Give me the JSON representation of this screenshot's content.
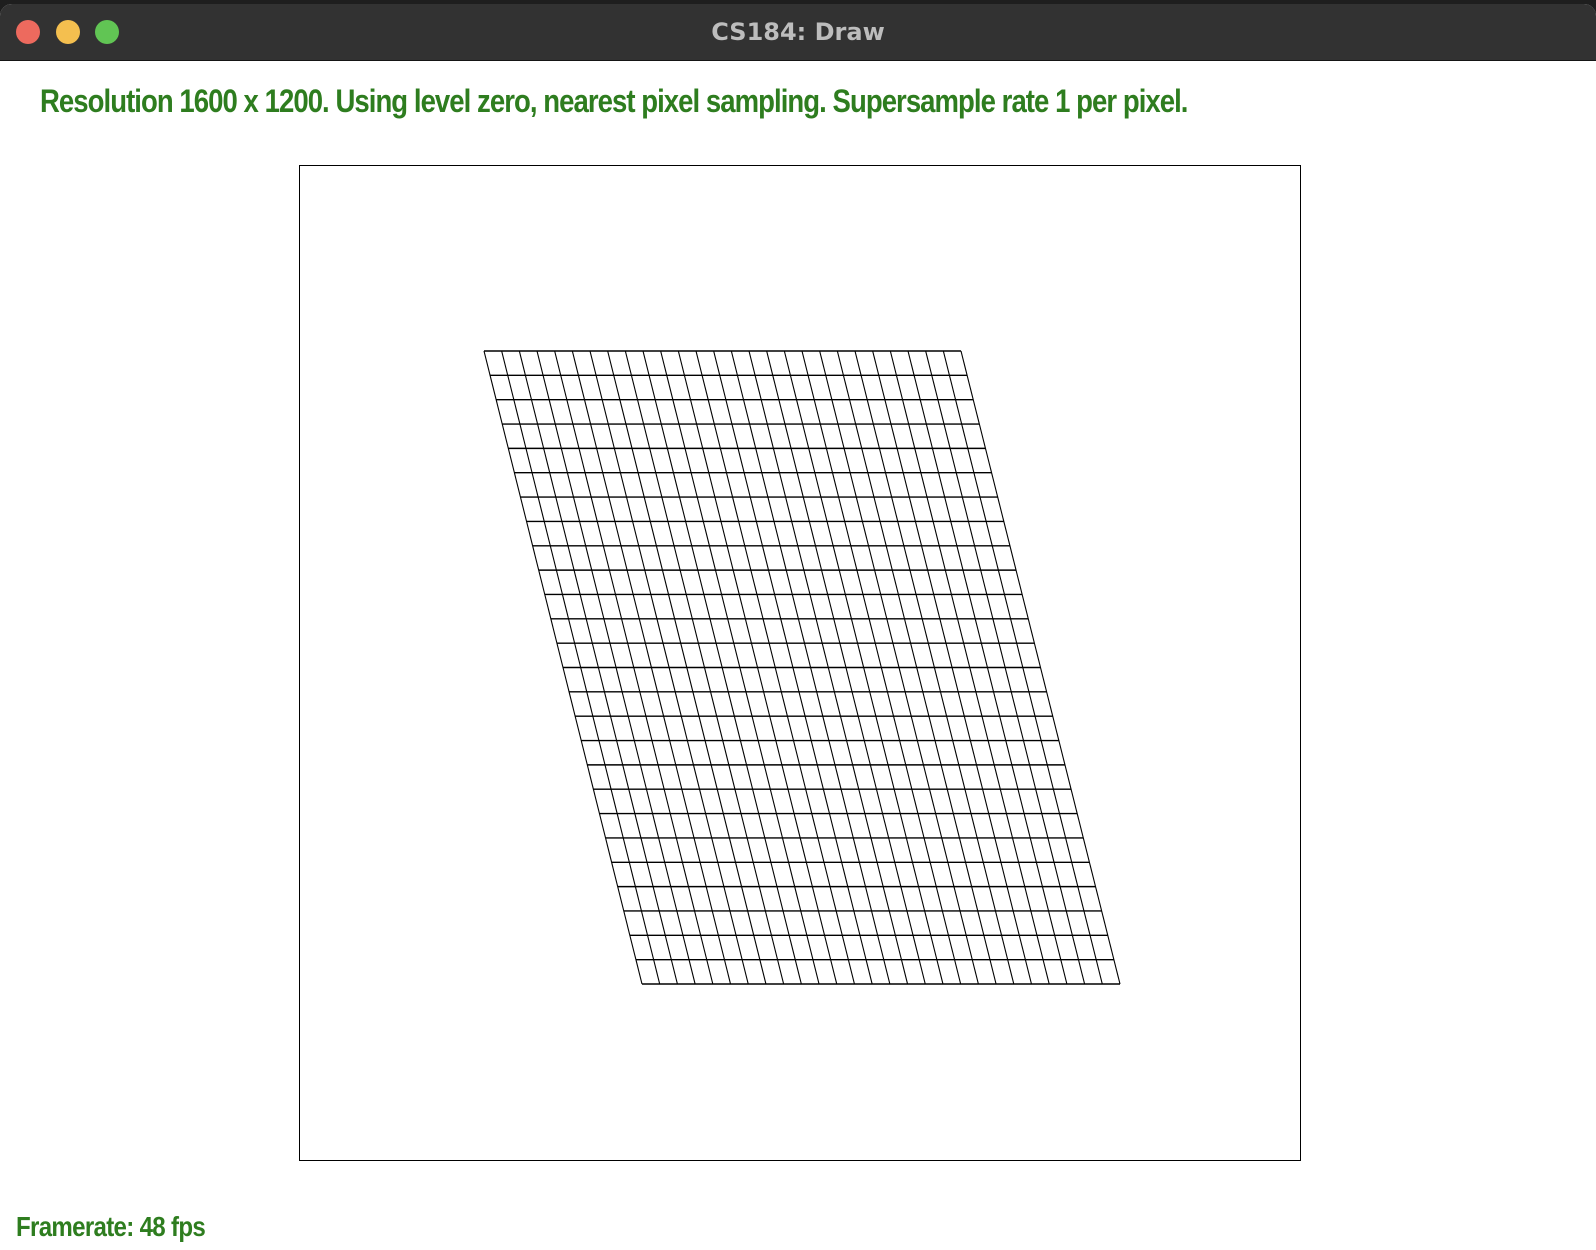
{
  "window": {
    "title": "CS184: Draw"
  },
  "status": {
    "text": "Resolution 1600 x 1200. Using level zero, nearest pixel sampling. Supersample rate 1 per pixel."
  },
  "footer": {
    "framerate": "Framerate: 48 fps"
  },
  "grid": {
    "columns": 27,
    "rows": 26,
    "line_color": "#000000"
  },
  "colors": {
    "status_text": "#2e7d1f",
    "titlebar": "#323232",
    "close": "#ed6a5e",
    "minimize": "#f4bf4f",
    "zoom": "#61c554"
  }
}
